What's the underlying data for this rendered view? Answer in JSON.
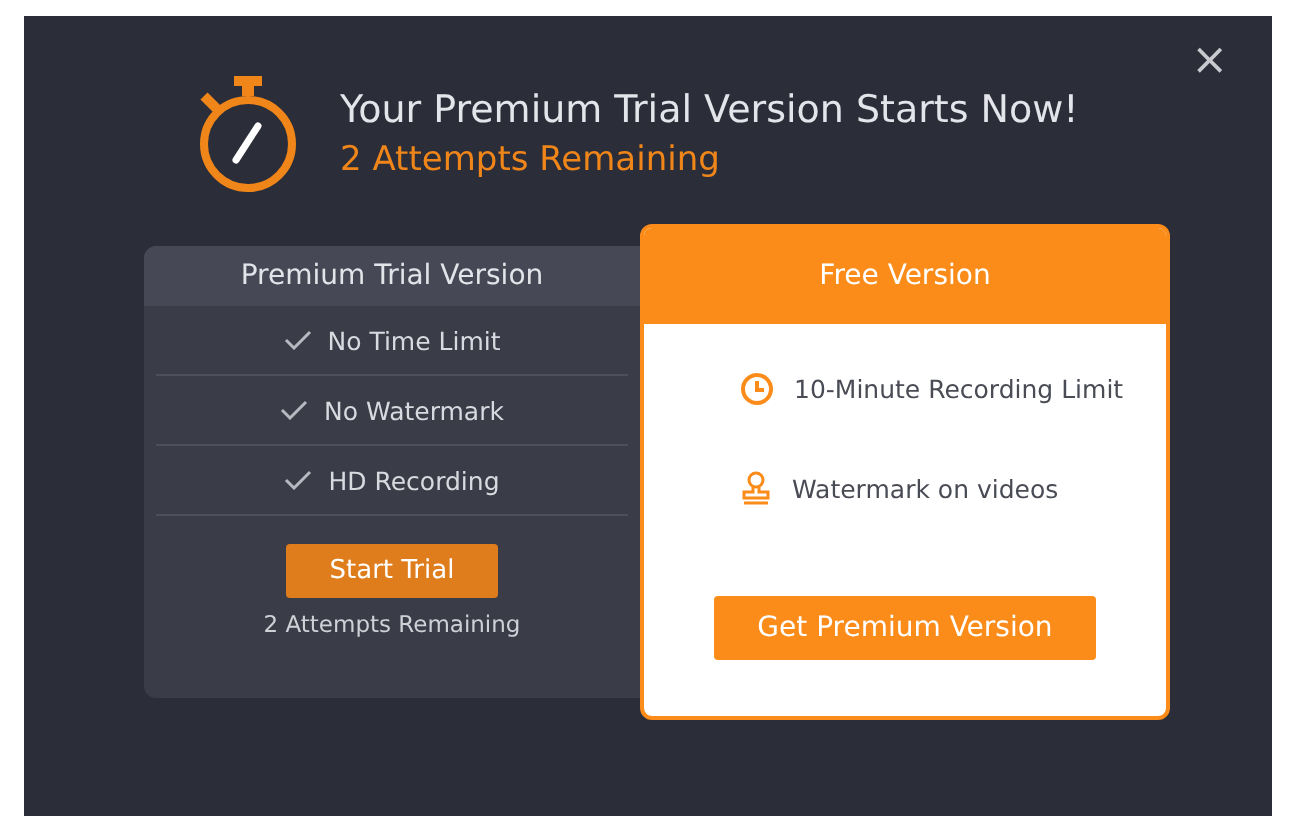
{
  "dialog": {
    "close": "×",
    "title": "Your Premium Trial Version Starts Now!",
    "subtitle": "2 Attempts Remaining"
  },
  "premium": {
    "title": "Premium Trial Version",
    "features": [
      "No Time Limit",
      "No Watermark",
      "HD Recording"
    ],
    "button": "Start Trial",
    "note": "2 Attempts Remaining"
  },
  "free": {
    "title": "Free Version",
    "features": [
      {
        "kind": "clock",
        "text": "10-Minute Recording Limit"
      },
      {
        "kind": "stamp",
        "text": "Watermark on videos"
      }
    ],
    "button": "Get Premium Version"
  }
}
